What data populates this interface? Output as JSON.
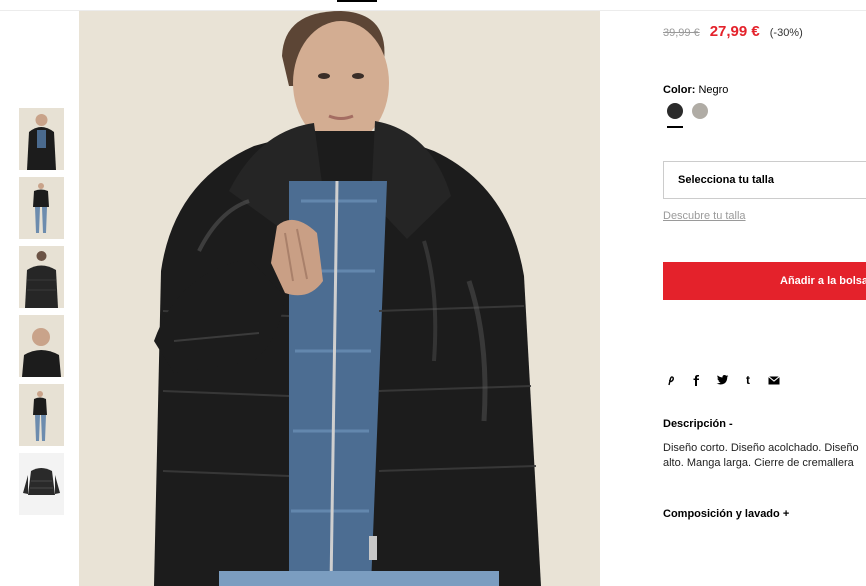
{
  "product": {
    "price": {
      "old": "39,99 €",
      "current": "27,99 €",
      "discount": "(-30%)"
    },
    "color": {
      "label": "Color:",
      "value": "Negro",
      "swatches": [
        {
          "name": "Negro",
          "hex": "#2b2b2b",
          "selected": true
        },
        {
          "name": "Gris",
          "hex": "#b0aca5",
          "selected": false
        }
      ]
    },
    "size": {
      "select_label": "Selecciona tu talla",
      "guide_link": "Descubre tu talla"
    },
    "add_to_bag": "Añadir a la bolsa",
    "share_icons": [
      "pinterest-icon",
      "facebook-icon",
      "twitter-icon",
      "tumblr-icon",
      "email-icon"
    ],
    "description": {
      "title": "Descripción",
      "toggle": "-",
      "line1": "Diseño corto. Diseño acolchado. Diseño",
      "line2": "alto. Manga larga. Cierre de cremallera"
    },
    "composition": {
      "title": "Composición y lavado",
      "toggle": "+"
    }
  },
  "gallery": {
    "thumbnails": [
      "front-view",
      "full-body-view",
      "back-view",
      "collar-detail",
      "full-body-side-view",
      "flat-lay-view"
    ],
    "selected": 0
  },
  "colors": {
    "accent": "#e4222b",
    "jacket": "#1c1c1c",
    "background": "#e9e3d6"
  }
}
